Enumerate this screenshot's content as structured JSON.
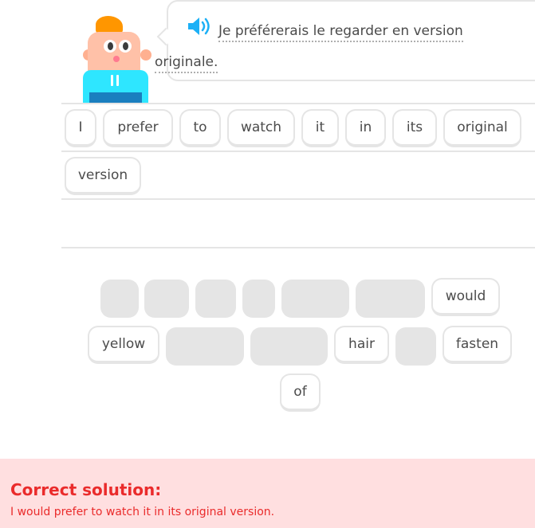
{
  "prompt": {
    "text_line1": "Je préférerais le regarder en version",
    "text_line2": "originale.",
    "speaker_icon": "speaker-icon"
  },
  "answer_row1": [
    "I",
    "prefer",
    "to",
    "watch",
    "it",
    "in",
    "its",
    "original"
  ],
  "answer_row2": [
    "version"
  ],
  "word_bank": {
    "row1_word": "would",
    "row2_words": [
      "yellow",
      "hair",
      "fasten"
    ],
    "row3_word": "of"
  },
  "footer": {
    "title": "Correct solution:",
    "solution": "I would prefer to watch it in its original version."
  },
  "colors": {
    "error_red": "#ea2b2b",
    "error_bg": "#ffdfe0",
    "speaker_blue": "#1cb0f6",
    "chip_border": "#e5e5e5"
  }
}
